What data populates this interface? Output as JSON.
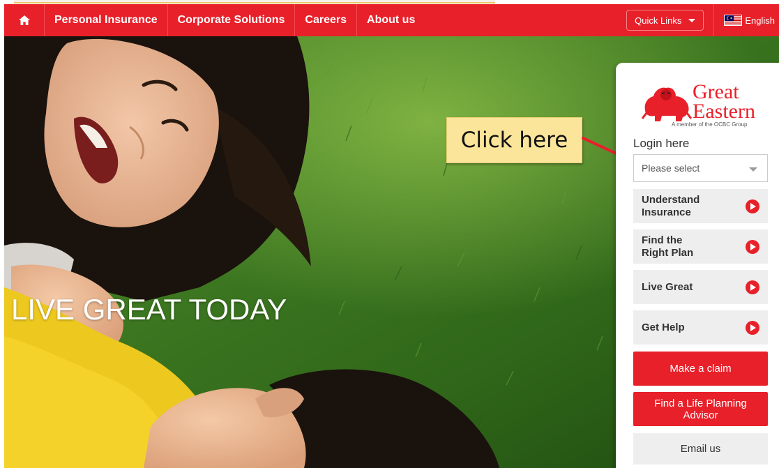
{
  "nav": {
    "items": [
      {
        "label": "Personal Insurance"
      },
      {
        "label": "Corporate Solutions"
      },
      {
        "label": "Careers"
      },
      {
        "label": "About us"
      }
    ],
    "quick_links": "Quick Links",
    "language": "English"
  },
  "hero": {
    "headline": "LIVE GREAT TODAY"
  },
  "callout": {
    "text": "Click here"
  },
  "panel": {
    "logo_great": "Great",
    "logo_eastern": "Eastern",
    "logo_tagline": "A member of the OCBC Group",
    "login_label": "Login here",
    "login_select_placeholder": "Please select",
    "menu": [
      {
        "line1": "Understand",
        "line2": "Insurance"
      },
      {
        "line1": "Find the",
        "line2": "Right Plan"
      },
      {
        "line1": "Live Great",
        "line2": ""
      },
      {
        "line1": "Get Help",
        "line2": ""
      }
    ],
    "make_claim": "Make a claim",
    "find_advisor_line1": "Find a Life Planning",
    "find_advisor_line2": "Advisor",
    "email_us": "Email us"
  },
  "colors": {
    "brand_red": "#e8202a",
    "callout_yellow": "#fbe59a",
    "menu_grey": "#eeeeee"
  }
}
